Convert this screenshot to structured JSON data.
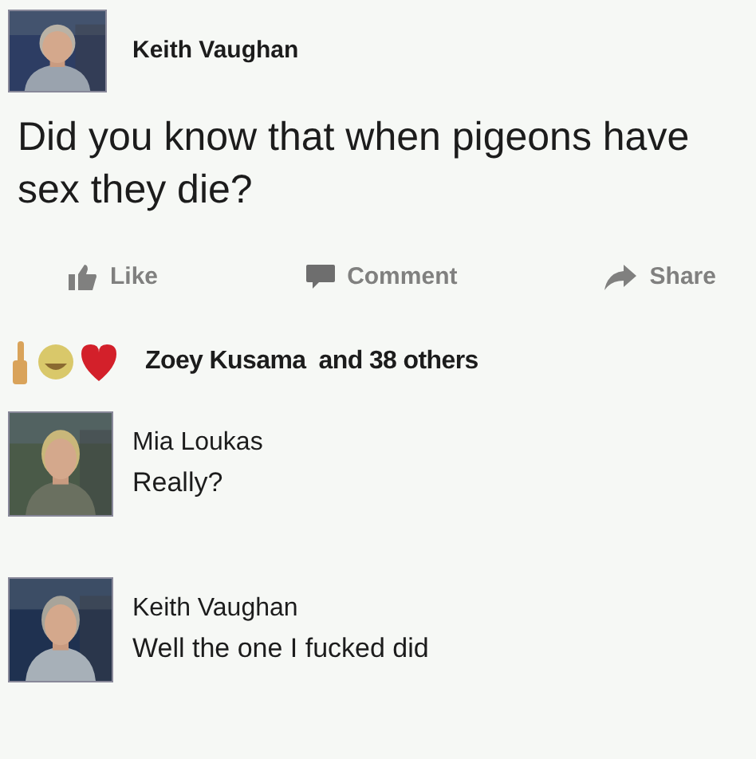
{
  "post": {
    "author": "Keith Vaughan",
    "text": "Did you know that when pigeons have sex they die?"
  },
  "actions": [
    {
      "kind": "like",
      "label": "Like"
    },
    {
      "kind": "comment",
      "label": "Comment"
    },
    {
      "kind": "share",
      "label": "Share"
    }
  ],
  "reactions": {
    "names": "Zoey Kusama",
    "others": "and 38 others"
  },
  "comments": [
    {
      "author": "Mia Loukas",
      "text": "Really?"
    },
    {
      "author": "Keith Vaughan",
      "text": "Well the one I fucked did"
    }
  ]
}
